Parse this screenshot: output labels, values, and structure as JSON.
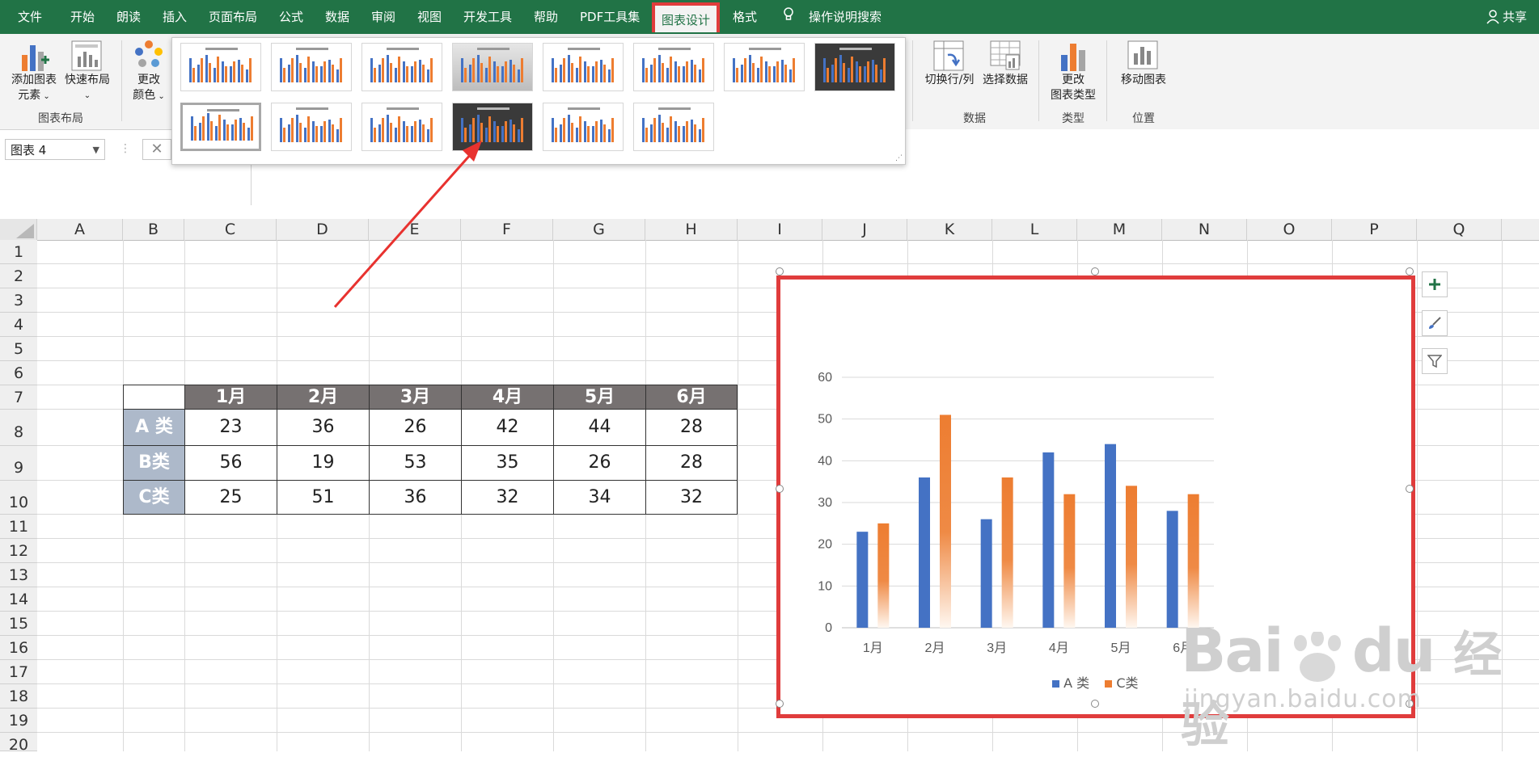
{
  "tabs": [
    "文件",
    "开始",
    "朗读",
    "插入",
    "页面布局",
    "公式",
    "数据",
    "审阅",
    "视图",
    "开发工具",
    "帮助",
    "PDF工具集",
    "图表设计",
    "格式"
  ],
  "active_tab": "图表设计",
  "tell_me": "操作说明搜索",
  "share": "共享",
  "ribbon": {
    "add_element_line1": "添加图表",
    "add_element_line2": "元素",
    "quick_layout": "快速布局",
    "change_colors_line1": "更改",
    "change_colors_line2": "颜色",
    "group_layout": "图表布局",
    "switch_row_col": "切换行/列",
    "select_data": "选择数据",
    "group_data": "数据",
    "change_type_line1": "更改",
    "change_type_line2": "图表类型",
    "group_type": "类型",
    "move_chart": "移动图表",
    "group_location": "位置"
  },
  "name_box": "图表 4",
  "columns": [
    "A",
    "B",
    "C",
    "D",
    "E",
    "F",
    "G",
    "H",
    "I",
    "J",
    "K",
    "L",
    "M",
    "N",
    "O",
    "P",
    "Q"
  ],
  "rows": [
    "1",
    "2",
    "3",
    "4",
    "5",
    "6",
    "7",
    "8",
    "9",
    "10",
    "11",
    "12",
    "13",
    "14",
    "15",
    "16",
    "17",
    "18",
    "19",
    "20"
  ],
  "table": {
    "months": [
      "1月",
      "2月",
      "3月",
      "4月",
      "5月",
      "6月"
    ],
    "rows": [
      {
        "label": "A 类",
        "values": [
          "23",
          "36",
          "26",
          "42",
          "44",
          "28"
        ]
      },
      {
        "label": "B类",
        "values": [
          "56",
          "19",
          "53",
          "35",
          "26",
          "28"
        ]
      },
      {
        "label": "C类",
        "values": [
          "25",
          "51",
          "36",
          "32",
          "34",
          "32"
        ]
      }
    ]
  },
  "colors": {
    "series_a": "#4472c4",
    "series_c": "#ed7d31",
    "excel_green": "#217346",
    "highlight": "#e03c3c"
  },
  "chart_data": {
    "type": "bar",
    "categories": [
      "1月",
      "2月",
      "3月",
      "4月",
      "5月",
      "6月"
    ],
    "series": [
      {
        "name": "A 类",
        "values": [
          23,
          36,
          26,
          42,
          44,
          28
        ]
      },
      {
        "name": "C类",
        "values": [
          25,
          51,
          36,
          32,
          34,
          32
        ]
      }
    ],
    "ylim": [
      0,
      60
    ],
    "yticks": [
      "0",
      "10",
      "20",
      "30",
      "40",
      "50",
      "60"
    ],
    "grid": true,
    "legend": "bottom"
  },
  "watermark": {
    "brand": "Bai",
    "brand2": "du",
    "cn": "经验",
    "url": "jingyan.baidu.com"
  }
}
